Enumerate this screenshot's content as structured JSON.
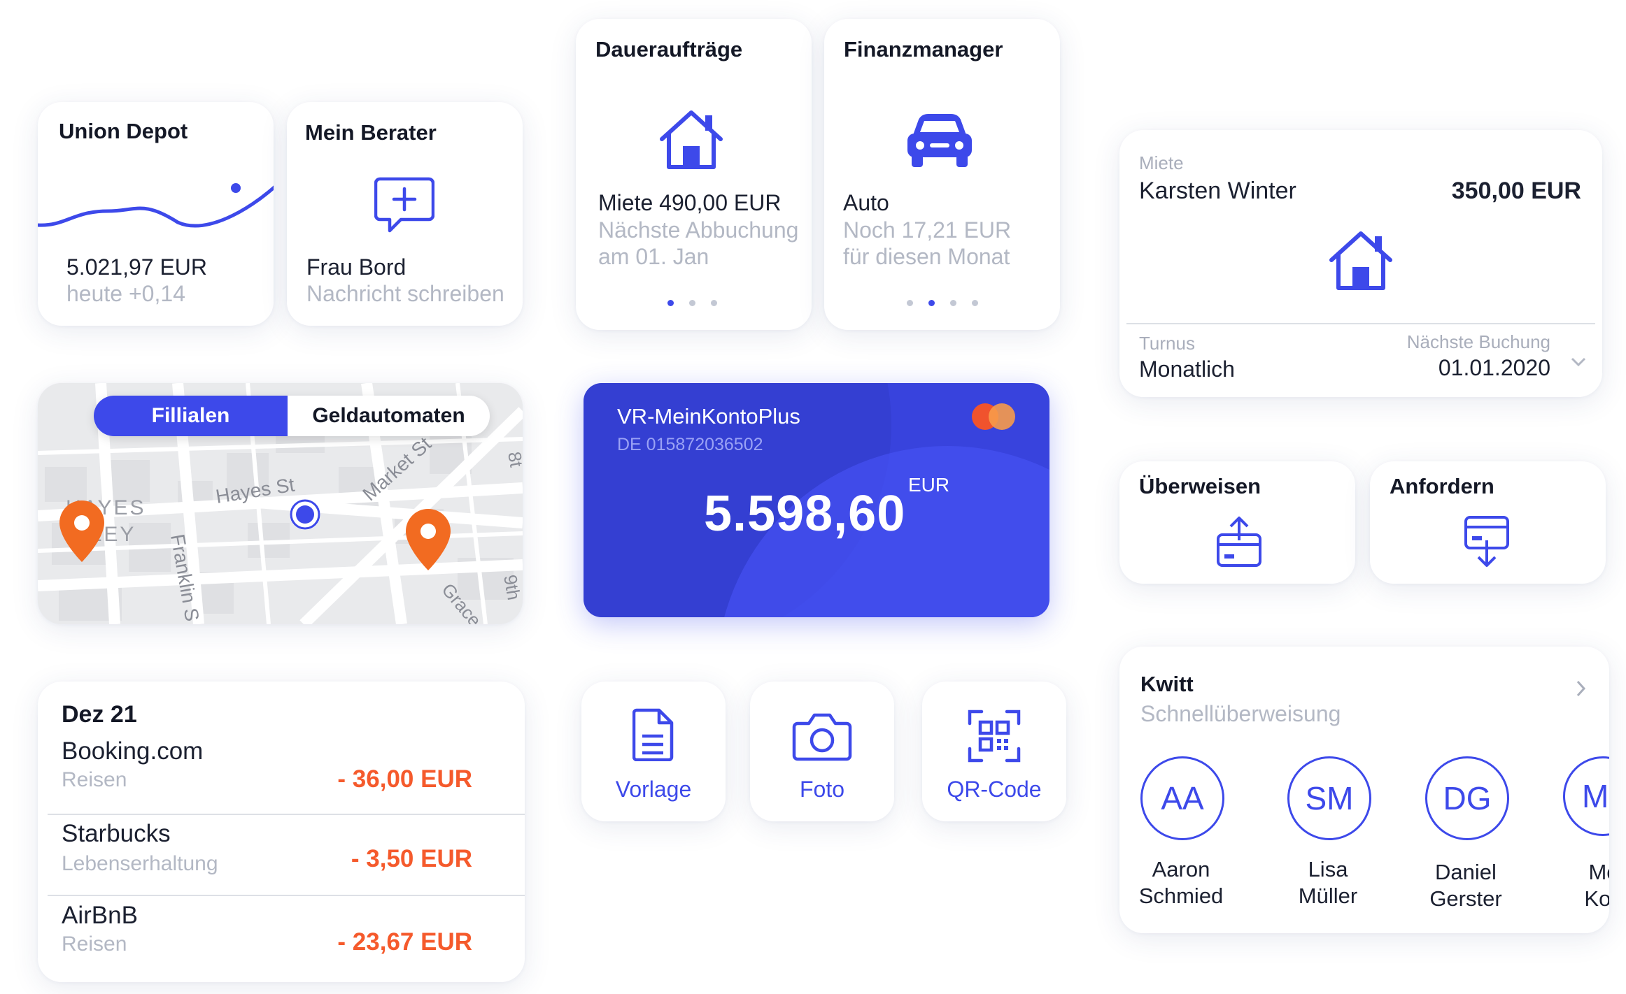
{
  "union_depot": {
    "title": "Union Depot",
    "amount": "5.021,97 EUR",
    "change": "heute +0,14"
  },
  "berater": {
    "title": "Mein Berater",
    "name": "Frau Bord",
    "action": "Nachricht schreiben"
  },
  "dauerauftraege": {
    "title": "Daueraufträge",
    "line1": "Miete 490,00 EUR",
    "line2": "Nächste Abbuchung",
    "line3": "am 01. Jan"
  },
  "finanzmanager": {
    "title": "Finanzmanager",
    "line1": "Auto",
    "line2": "Noch 17,21 EUR",
    "line3": "für diesen Monat"
  },
  "map": {
    "tab_active": "Fillialen",
    "tab_inactive": "Geldautomaten",
    "streets": [
      "Hayes St",
      "Market St",
      "Franklin S",
      "HAYES",
      "LLEY",
      "Grace",
      "8t",
      "9th"
    ]
  },
  "konto": {
    "name": "VR-MeinKontoPlus",
    "iban": "DE 015872036502",
    "currency": "EUR",
    "balance": "5.598,60"
  },
  "miete": {
    "label": "Miete",
    "recipient": "Karsten Winter",
    "amount": "350,00 EUR",
    "turnus_label": "Turnus",
    "turnus_value": "Monatlich",
    "next_label": "Nächste Buchung",
    "next_value": "01.01.2020"
  },
  "actions": {
    "ueberweisen": "Überweisen",
    "anfordern": "Anfordern"
  },
  "transactions": {
    "date": "Dez 21",
    "items": [
      {
        "merchant": "Booking.com",
        "category": "Reisen",
        "amount": "- 36,00 EUR"
      },
      {
        "merchant": "Starbucks",
        "category": "Lebenserhaltung",
        "amount": "- 3,50 EUR"
      },
      {
        "merchant": "AirBnB",
        "category": "Reisen",
        "amount": "- 23,67 EUR"
      }
    ]
  },
  "quick_actions": {
    "vorlage": "Vorlage",
    "foto": "Foto",
    "qr": "QR-Code"
  },
  "kwitt": {
    "title": "Kwitt",
    "subtitle": "Schnellüberweisung",
    "contacts": [
      {
        "initials": "AA",
        "first": "Aaron",
        "last": "Schmied"
      },
      {
        "initials": "SM",
        "first": "Lisa",
        "last": "Müller"
      },
      {
        "initials": "DG",
        "first": "Daniel",
        "last": "Gerster"
      },
      {
        "initials": "M",
        "first": "Mo",
        "last": "Kon"
      }
    ]
  },
  "colors": {
    "accent": "#3d49ea",
    "negative": "#f55a2c",
    "muted": "#b3b8c4",
    "map_pin": "#f26b21"
  }
}
